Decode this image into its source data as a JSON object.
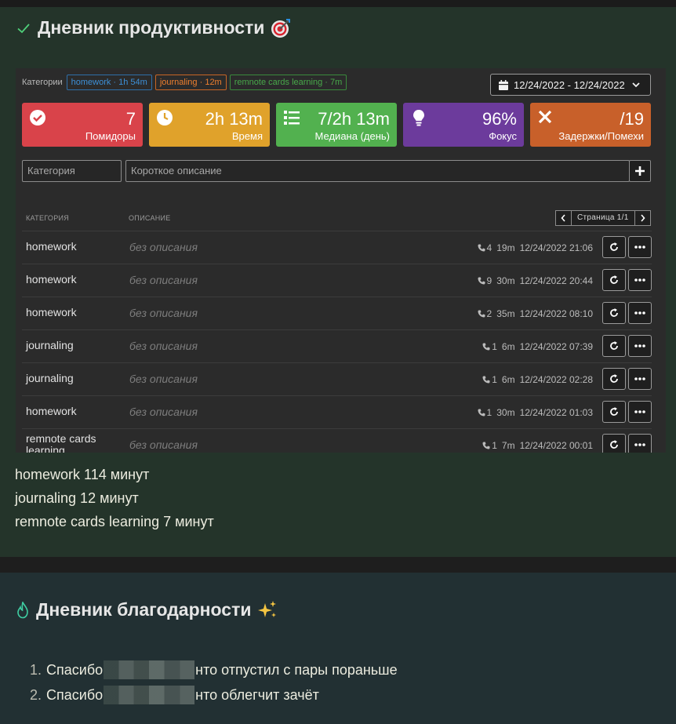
{
  "productivity": {
    "title": "Дневник продуктивности",
    "filters": {
      "label": "Категории",
      "tags": [
        {
          "text": "homework · 1h 54m",
          "color": "#3d8fd6"
        },
        {
          "text": "journaling · 12m",
          "color": "#ee7f2e"
        },
        {
          "text": "remnote cards learning · 7m",
          "color": "#48a84a"
        }
      ]
    },
    "date_range": "12/24/2022 - 12/24/2022",
    "cards": [
      {
        "value": "7",
        "label": "Помидоры",
        "icon": "check-circle-icon",
        "color": "#d9434a"
      },
      {
        "value": "2h 13m",
        "label": "Время",
        "icon": "clock-icon",
        "color": "#e0a22b"
      },
      {
        "value": "7/2h 13m",
        "label": "Медиана (день)",
        "icon": "list-icon",
        "color": "#52b14f"
      },
      {
        "value": "96%",
        "label": "Фокус",
        "icon": "lightbulb-icon",
        "color": "#6c3b9c"
      },
      {
        "value": "/19",
        "label": "Задержки/Помехи",
        "icon": "x-icon",
        "color": "#c8602a"
      }
    ],
    "inputs": {
      "category_placeholder": "Категория",
      "description_placeholder": "Короткое описание",
      "add_label": "+"
    },
    "table": {
      "col_category": "КАТЕГОРИЯ",
      "col_description": "ОПИСАНИЕ",
      "page_label": "Страница 1/1",
      "rows": [
        {
          "category": "homework",
          "description": "без описания",
          "count": "4",
          "duration": "19m",
          "timestamp": "12/24/2022 21:06"
        },
        {
          "category": "homework",
          "description": "без описания",
          "count": "9",
          "duration": "30m",
          "timestamp": "12/24/2022 20:44"
        },
        {
          "category": "homework",
          "description": "без описания",
          "count": "2",
          "duration": "35m",
          "timestamp": "12/24/2022 08:10"
        },
        {
          "category": "journaling",
          "description": "без описания",
          "count": "1",
          "duration": "6m",
          "timestamp": "12/24/2022 07:39"
        },
        {
          "category": "journaling",
          "description": "без описания",
          "count": "1",
          "duration": "6m",
          "timestamp": "12/24/2022 02:28"
        },
        {
          "category": "homework",
          "description": "без описания",
          "count": "1",
          "duration": "30m",
          "timestamp": "12/24/2022 01:03"
        },
        {
          "category": "remnote cards learning",
          "description": "без описания",
          "count": "1",
          "duration": "7m",
          "timestamp": "12/24/2022 00:01"
        }
      ]
    },
    "summary": [
      "homework 114 минут",
      "journaling 12 минут",
      "remnote cards learning 7 минут"
    ]
  },
  "gratitude": {
    "title": "Дневник благодарности",
    "items": [
      {
        "num": "1.",
        "before": "Спасибо",
        "after": "нто отпустил с пары пораньше"
      },
      {
        "num": "2.",
        "before": "Спасибо",
        "after": "нто облегчит зачёт"
      }
    ]
  }
}
